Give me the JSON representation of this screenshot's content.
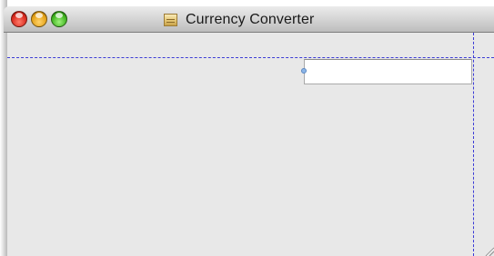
{
  "window": {
    "title": "Currency Converter",
    "title_icon": "document-icon",
    "controls": [
      "close",
      "minimize",
      "zoom"
    ]
  },
  "text_field": {
    "value": "",
    "placeholder": ""
  },
  "colors": {
    "guide": "#3b3bd6",
    "content_background": "#e8e8e8",
    "close": "#d8291d",
    "minimize": "#e3a016",
    "zoom": "#3fb31f"
  }
}
